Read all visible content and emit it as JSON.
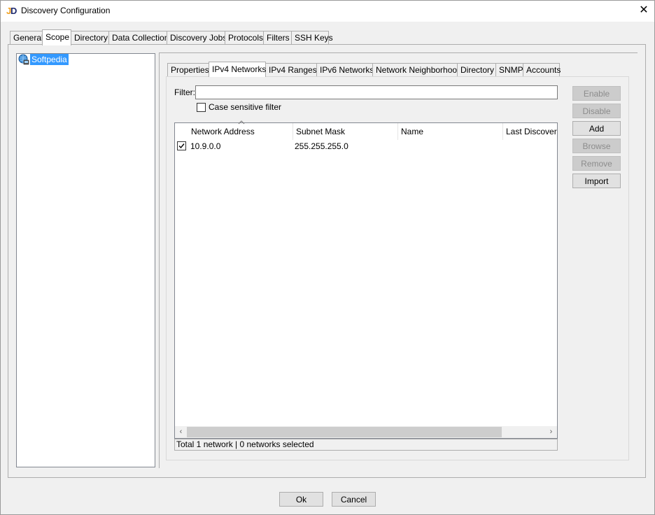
{
  "window": {
    "title": "Discovery Configuration",
    "close_glyph": "✕"
  },
  "main_tabs": [
    {
      "label": "General"
    },
    {
      "label": "Scope"
    },
    {
      "label": "Directory"
    },
    {
      "label": "Data Collection"
    },
    {
      "label": "Discovery Jobs"
    },
    {
      "label": "Protocols"
    },
    {
      "label": "Filters"
    },
    {
      "label": "SSH Keys"
    }
  ],
  "active_main_tab": "Scope",
  "tree": {
    "items": [
      {
        "label": "Softpedia",
        "icon": "network-globe-icon",
        "selected": true
      }
    ]
  },
  "scope_tabs": [
    {
      "label": "Properties"
    },
    {
      "label": "IPv4 Networks"
    },
    {
      "label": "IPv4 Ranges"
    },
    {
      "label": "IPv6 Networks"
    },
    {
      "label": "Network Neighborhood"
    },
    {
      "label": "Directory"
    },
    {
      "label": "SNMP"
    },
    {
      "label": "Accounts"
    }
  ],
  "active_scope_tab": "IPv4 Networks",
  "filter": {
    "label": "Filter:",
    "value": "",
    "case_sensitive_label": "Case sensitive filter",
    "case_sensitive_checked": false
  },
  "table": {
    "columns": [
      {
        "label": "Network Address",
        "sorted": "ascending"
      },
      {
        "label": "Subnet Mask"
      },
      {
        "label": "Name"
      },
      {
        "label": "Last Discovered"
      }
    ],
    "rows": [
      {
        "checked": true,
        "network_address": "10.9.0.0",
        "subnet_mask": "255.255.255.0",
        "name": "",
        "last_discovered": ""
      }
    ]
  },
  "status": "Total 1 network | 0 networks selected",
  "side_buttons": [
    {
      "label": "Enable",
      "enabled": false
    },
    {
      "label": "Disable",
      "enabled": false
    },
    {
      "label": "Add",
      "enabled": true
    },
    {
      "label": "Browse",
      "enabled": false
    },
    {
      "label": "Remove",
      "enabled": false
    },
    {
      "label": "Import",
      "enabled": true
    }
  ],
  "dialog_buttons": {
    "ok": "Ok",
    "cancel": "Cancel"
  },
  "colors": {
    "selection": "#3399ff",
    "window_bg": "#f0f0f0",
    "disabled_text": "#8c8c8c"
  }
}
